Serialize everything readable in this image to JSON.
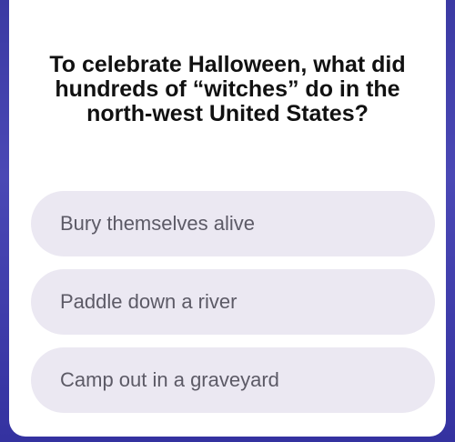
{
  "quiz": {
    "question": "To celebrate Halloween, what did hundreds of “witches” do in the north-west United States?",
    "options": [
      {
        "label": "Bury themselves alive"
      },
      {
        "label": "Paddle down a river"
      },
      {
        "label": "Camp out in a graveyard"
      }
    ]
  },
  "colors": {
    "background": "#3b3aa3",
    "card": "#ffffff",
    "option_bg": "#ebe8f2",
    "option_text": "#5c5a66",
    "question_text": "#111111"
  }
}
